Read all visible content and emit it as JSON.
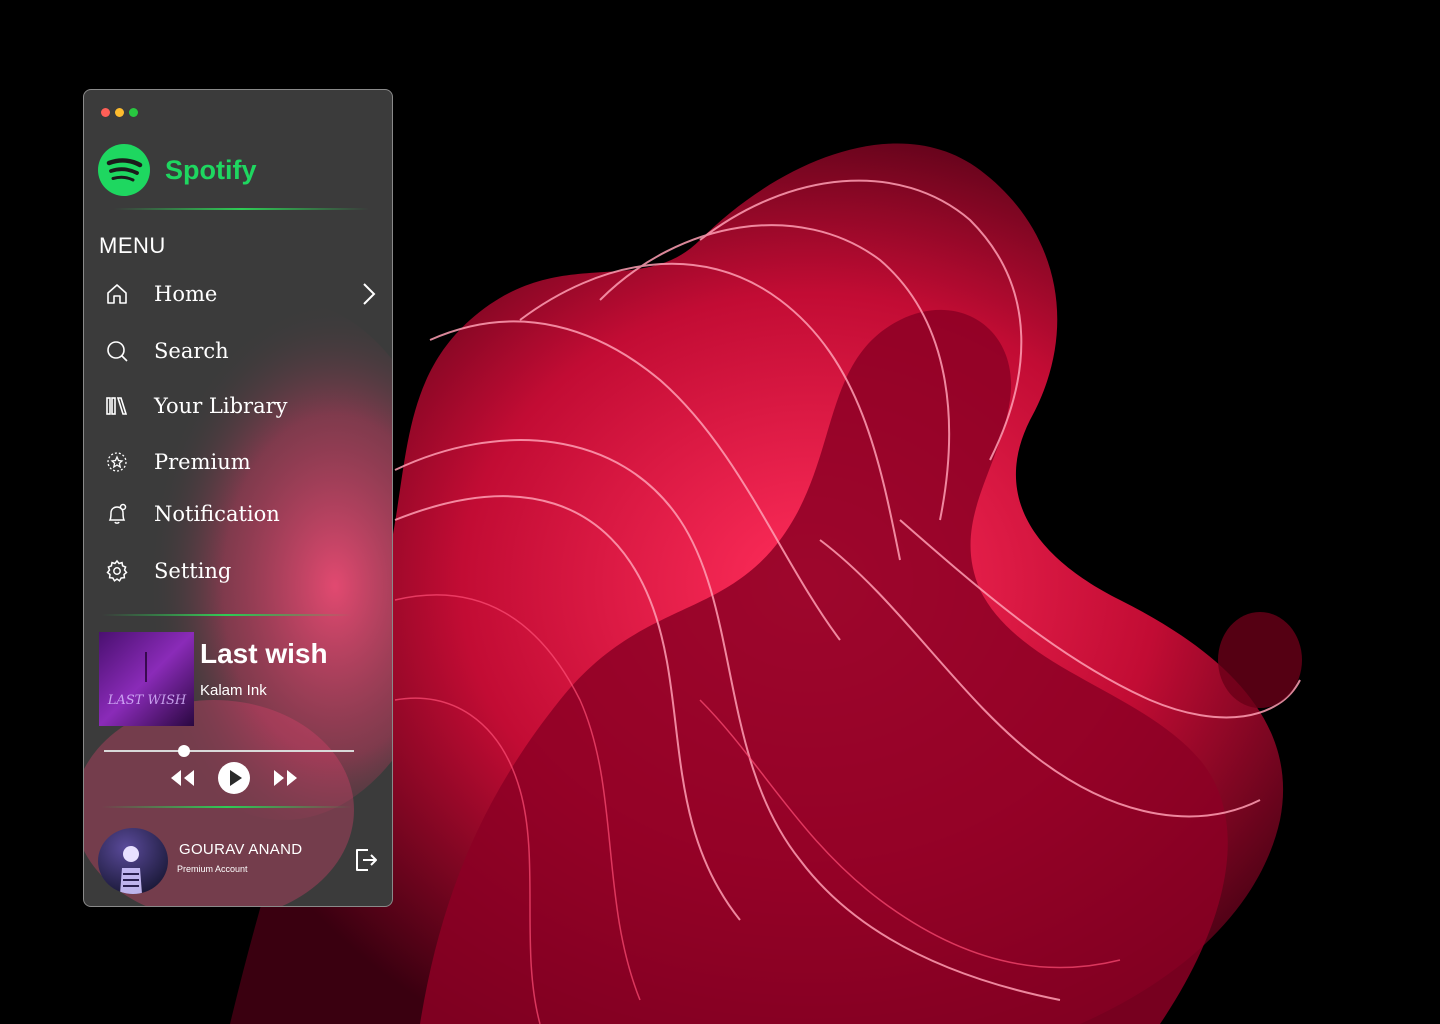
{
  "window": {
    "controls": [
      {
        "name": "close",
        "color": "#ff5f57"
      },
      {
        "name": "minimize",
        "color": "#febc2e"
      },
      {
        "name": "zoom",
        "color": "#28c840"
      }
    ]
  },
  "brand": {
    "name": "Spotify",
    "icon": "spotify-logo-icon",
    "color": "#1ed760"
  },
  "menu": {
    "heading": "MENU",
    "items": [
      {
        "label": "Home",
        "icon": "home-icon"
      },
      {
        "label": "Search",
        "icon": "search-icon"
      },
      {
        "label": "Your Library",
        "icon": "library-icon"
      },
      {
        "label": "Premium",
        "icon": "premium-badge-icon"
      },
      {
        "label": "Notification",
        "icon": "bell-icon"
      },
      {
        "label": "Setting",
        "icon": "gear-icon"
      }
    ]
  },
  "now_playing": {
    "title": "Last wish",
    "artist": "Kalam Ink",
    "album_art_text": "LAST WISH",
    "progress": 0.32,
    "controls": [
      "rewind-icon",
      "play-icon",
      "fast-forward-icon"
    ]
  },
  "user": {
    "name": "GOURAV ANAND",
    "plan": "Premium Account",
    "action_icon": "logout-icon"
  },
  "colors": {
    "accent": "#1ed760",
    "wallpaper": "#e0123f",
    "panel": "#3b3b3b"
  }
}
